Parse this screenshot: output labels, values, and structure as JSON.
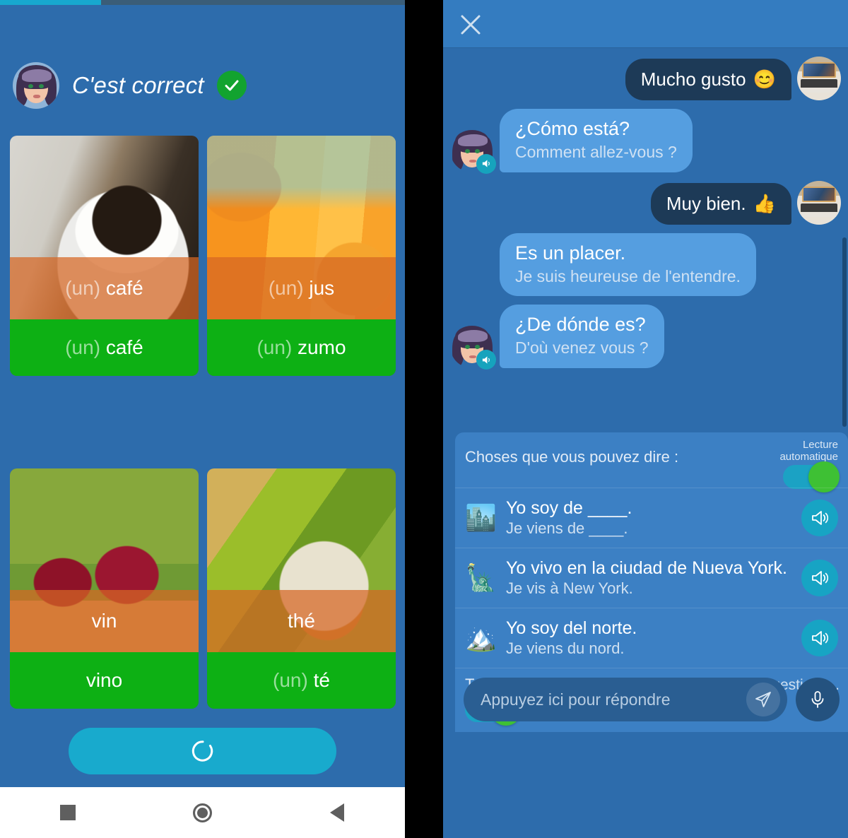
{
  "left_phone": {
    "progress": {
      "percent": 25
    },
    "feedback": {
      "text": "C'est correct",
      "icon": "check-circle-icon"
    },
    "cards": [
      {
        "prompt_article": "(un)",
        "prompt_word": "café",
        "answer_article": "(un)",
        "answer_word": "café",
        "image": "coffee-cup-newspaper"
      },
      {
        "prompt_article": "(un)",
        "prompt_word": "jus",
        "answer_article": "(un)",
        "answer_word": "zumo",
        "image": "orange-juice-glasses"
      },
      {
        "prompt_article": "",
        "prompt_word": "vin",
        "answer_article": "",
        "answer_word": "vino",
        "image": "red-wine-glasses"
      },
      {
        "prompt_article": "",
        "prompt_word": "thé",
        "answer_article": "(un)",
        "answer_word": "té",
        "image": "tea-pouring-cup"
      }
    ],
    "continue_button": {
      "state": "loading",
      "icon": "spinner-icon"
    }
  },
  "right_phone": {
    "header": {
      "close_icon": "close-icon"
    },
    "messages": [
      {
        "from": "user",
        "text": "Mucho gusto",
        "emoji": "😊",
        "avatar": "laptop-photo"
      },
      {
        "from": "bot",
        "primary": "¿Cómo está?",
        "secondary": "Comment allez-vous ?",
        "avatar": "lady-avatar",
        "speaker_icon": "speaker-icon"
      },
      {
        "from": "user",
        "text": "Muy bien.",
        "emoji": "👍",
        "avatar": "laptop-photo"
      },
      {
        "from": "bot",
        "primary": "Es un placer.",
        "secondary": "Je suis heureuse de l'entendre.",
        "avatar": null,
        "speaker_icon": null
      },
      {
        "from": "bot",
        "primary": "¿De dónde es?",
        "secondary": "D'où venez vous ?",
        "avatar": "lady-avatar",
        "speaker_icon": "speaker-icon"
      }
    ],
    "suggestions": {
      "title": "Choses que vous pouvez dire :",
      "autoplay_label": "Lecture\nautomatique",
      "autoplay_label_line1": "Lecture",
      "autoplay_label_line2": "automatique",
      "autoplay_on": true,
      "items": [
        {
          "emoji": "🏙️",
          "primary": "Yo soy de ____.",
          "secondary": "Je viens de ____.",
          "speaker_icon": "speaker-icon"
        },
        {
          "emoji": "🗽",
          "primary": "Yo vivo en la ciudad de Nueva York.",
          "secondary": "Je vis à New York.",
          "speaker_icon": "speaker-icon"
        },
        {
          "emoji": "🏔️",
          "primary": "Yo soy del norte.",
          "secondary": "Je viens du nord.",
          "speaker_icon": "speaker-icon"
        }
      ],
      "translations_label": "Traductions",
      "translations_on": true,
      "more_suggestions": "Plus de suggestions..."
    },
    "input": {
      "placeholder": "Appuyez ici pour répondre",
      "value": "",
      "send_icon": "send-icon",
      "mic_icon": "microphone-icon"
    }
  },
  "navbar": {
    "recents_label": "recents-icon",
    "home_label": "home-icon",
    "back_label": "back-icon"
  },
  "colors": {
    "background_blue": "#2d6cac",
    "panel_blue": "#3c80c4",
    "bubble_in": "#559ee0",
    "bubble_out": "#1d3a57",
    "green_answer": "#0db014",
    "orange_overlay": "#d66624",
    "accent_cyan": "#18aacd",
    "toggle_green": "#3ec034",
    "check_green": "#12a32f"
  }
}
